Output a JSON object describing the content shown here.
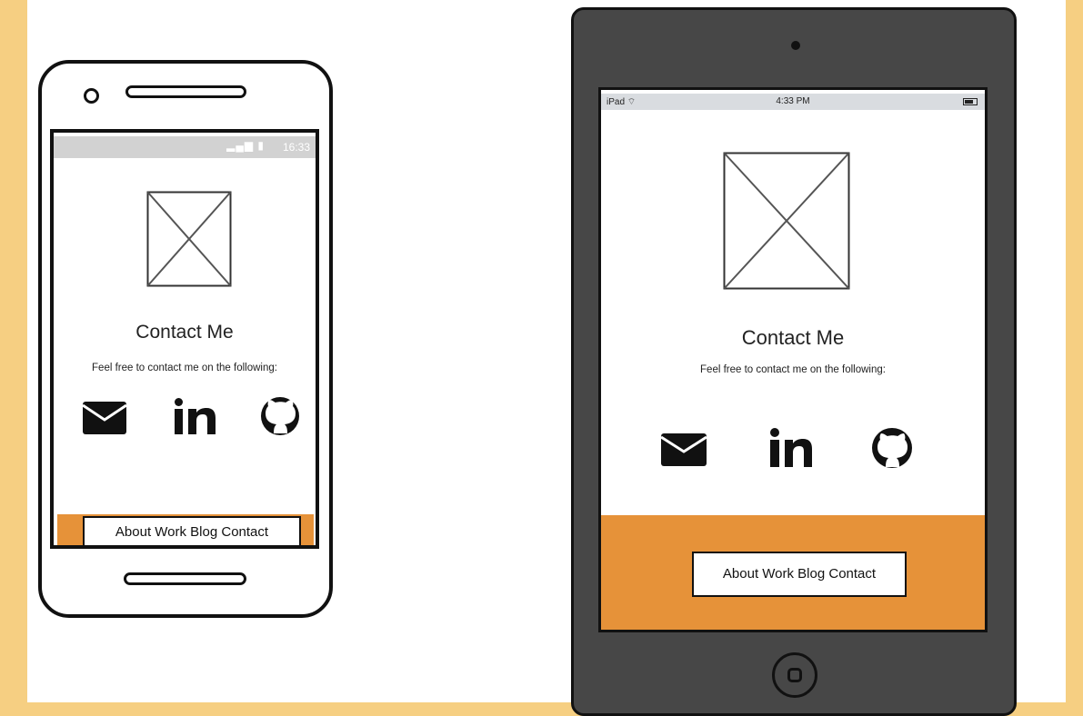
{
  "colors": {
    "page_bg": "#f6cf82",
    "accent": "#e69239",
    "device_dark": "#474747"
  },
  "phone": {
    "status": {
      "signal_icons": "wifi-signal-battery",
      "time": "16:33"
    },
    "image_placeholder": "image-placeholder-icon",
    "title": "Contact Me",
    "text": "Feel free to contact me on the following:",
    "icons": [
      "envelope-icon",
      "linkedin-icon",
      "github-icon"
    ],
    "nav_label": "About Work Blog Contact"
  },
  "tablet": {
    "status": {
      "carrier": "iPad ⌔",
      "time": "4:33 PM"
    },
    "image_placeholder": "image-placeholder-icon",
    "title": "Contact Me",
    "text": "Feel free to contact me on the following:",
    "icons": [
      "envelope-icon",
      "linkedin-icon",
      "github-icon"
    ],
    "nav_label": "About Work Blog Contact"
  }
}
